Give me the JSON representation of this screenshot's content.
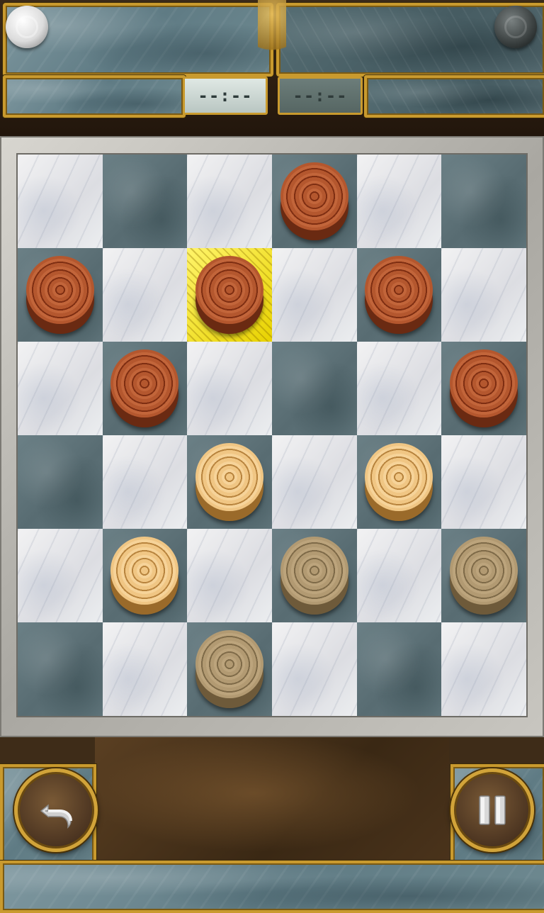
{
  "hud": {
    "timer_white": "--:--",
    "timer_black": "--:--"
  },
  "board": {
    "rows": 6,
    "cols": 6,
    "selected_cell": [
      1,
      2
    ],
    "pieces": [
      {
        "row": 0,
        "col": 3,
        "type": "red"
      },
      {
        "row": 1,
        "col": 0,
        "type": "red"
      },
      {
        "row": 1,
        "col": 2,
        "type": "red"
      },
      {
        "row": 1,
        "col": 4,
        "type": "red"
      },
      {
        "row": 2,
        "col": 1,
        "type": "red"
      },
      {
        "row": 2,
        "col": 5,
        "type": "red"
      },
      {
        "row": 3,
        "col": 2,
        "type": "light-wood"
      },
      {
        "row": 3,
        "col": 4,
        "type": "light-wood"
      },
      {
        "row": 4,
        "col": 1,
        "type": "light-wood"
      },
      {
        "row": 4,
        "col": 3,
        "type": "faded"
      },
      {
        "row": 4,
        "col": 5,
        "type": "faded"
      },
      {
        "row": 5,
        "col": 2,
        "type": "faded"
      }
    ]
  },
  "controls": {
    "undo_icon": "undo-arrow-icon",
    "pause_icon": "pause-icon"
  },
  "colors": {
    "accent_gold": "#c99a2e",
    "selection": "#f0e020",
    "piece_red": "#a04a25",
    "piece_light": "#e8b86e"
  }
}
